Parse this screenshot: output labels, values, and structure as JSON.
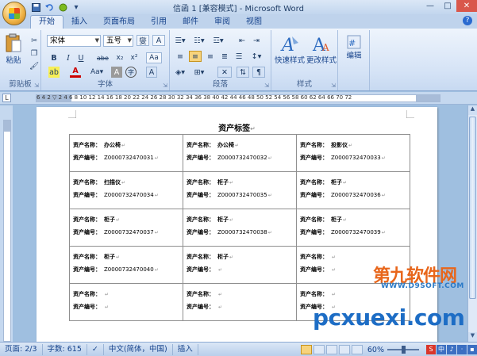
{
  "window": {
    "title": "信函 1 [兼容模式] - Microsoft Word",
    "controls": {
      "minimize": "—",
      "maximize": "□",
      "close": "✕"
    }
  },
  "qat": {
    "save_icon": "save-icon",
    "undo_icon": "undo-icon",
    "redo_icon": "redo-icon",
    "more": "▾"
  },
  "tabs": [
    {
      "label": "开始",
      "active": true
    },
    {
      "label": "插入"
    },
    {
      "label": "页面布局"
    },
    {
      "label": "引用"
    },
    {
      "label": "邮件"
    },
    {
      "label": "审阅"
    },
    {
      "label": "视图"
    }
  ],
  "help": "?",
  "ribbon": {
    "clipboard": {
      "label": "剪贴板",
      "paste": "粘贴"
    },
    "font": {
      "label": "字体",
      "font_name": "宋体",
      "font_size": "五号",
      "buttons": [
        "B",
        "I",
        "U",
        "abe",
        "x₂",
        "x²",
        "Aa",
        "A",
        "A",
        "A"
      ]
    },
    "paragraph": {
      "label": "段落"
    },
    "styles": {
      "label": "样式",
      "quick_styles": "快速样式",
      "change_styles": "更改样式"
    },
    "editing": {
      "label": "编辑"
    }
  },
  "ruler": {
    "corner": "L",
    "ticks": "6  4  2  ▽  2  4  6  8  10 12 14 16 18 20 22 24 26 28 30 32 34 36 38 40 42 44 46 48 50 52 54 56 58 60 62 64 66  70  72"
  },
  "document": {
    "title": "资产标签",
    "paragraph_mark": "↵",
    "labels": {
      "name": "资产名称：",
      "number": "资产编号："
    },
    "rows": [
      [
        {
          "name": "办公椅",
          "number": "Z0000732470031"
        },
        {
          "name": "办公椅",
          "number": "Z0000732470032"
        },
        {
          "name": "投影仪",
          "number": "Z0000732470033"
        }
      ],
      [
        {
          "name": "扫描仪",
          "number": "Z0000732470034"
        },
        {
          "name": "柜子",
          "number": "Z0000732470035"
        },
        {
          "name": "柜子",
          "number": "Z0000732470036"
        }
      ],
      [
        {
          "name": "柜子",
          "number": "Z0000732470037"
        },
        {
          "name": "柜子",
          "number": "Z0000732470038"
        },
        {
          "name": "柜子",
          "number": "Z0000732470039"
        }
      ],
      [
        {
          "name": "柜子",
          "number": "Z0000732470040"
        },
        {
          "name": "柜子",
          "number": ""
        },
        {
          "name": "",
          "number": ""
        }
      ],
      [
        {
          "name": "",
          "number": ""
        },
        {
          "name": "",
          "number": ""
        },
        {
          "name": "",
          "number": ""
        }
      ]
    ]
  },
  "watermarks": {
    "site_cn": "第九软件网",
    "site_url": "WWW.D9SOFT.COM",
    "pcxuexi": "pcxuexi.com"
  },
  "status": {
    "page": "页面: 2/3",
    "words": "字数: 615",
    "language": "中文(简体，中国)",
    "mode": "插入",
    "zoom": "60%",
    "ime": [
      "S",
      "中",
      "♪",
      "·",
      "▪"
    ]
  }
}
